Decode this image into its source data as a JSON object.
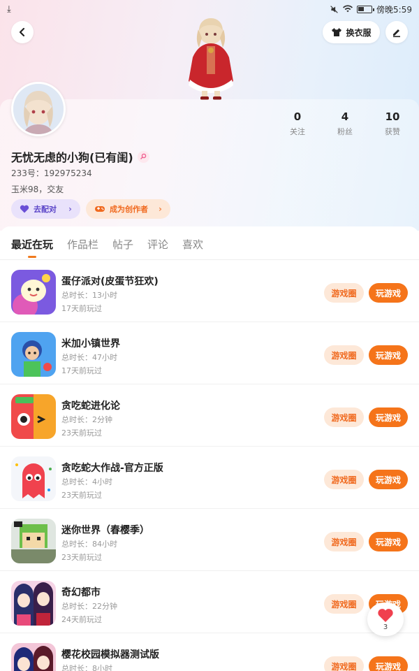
{
  "status_bar": {
    "time": "傍晚5:59"
  },
  "header": {
    "outfit_label": "换衣服"
  },
  "profile": {
    "stats": [
      {
        "value": "0",
        "label": "关注"
      },
      {
        "value": "4",
        "label": "粉丝"
      },
      {
        "value": "10",
        "label": "获赞"
      }
    ],
    "username": "无忧无虑的小狗(已有闺)",
    "uid": "233号：192975234",
    "bio": "玉米98，交友",
    "match_label": "去配对",
    "creator_label": "成为创作者"
  },
  "tabs": [
    {
      "label": "最近在玩",
      "active": true
    },
    {
      "label": "作品栏",
      "active": false
    },
    {
      "label": "帖子",
      "active": false
    },
    {
      "label": "评论",
      "active": false
    },
    {
      "label": "喜欢",
      "active": false
    }
  ],
  "games": [
    {
      "name": "蛋仔派对(皮蛋节狂欢)",
      "duration": "总时长：13小时",
      "last_played": "17天前玩过",
      "circle_label": "游戏圈",
      "play_label": "玩游戏"
    },
    {
      "name": "米加小镇世界",
      "duration": "总时长：47小时",
      "last_played": "17天前玩过",
      "circle_label": "游戏圈",
      "play_label": "玩游戏"
    },
    {
      "name": "贪吃蛇进化论",
      "duration": "总时长：2分钟",
      "last_played": "23天前玩过",
      "circle_label": "游戏圈",
      "play_label": "玩游戏"
    },
    {
      "name": "贪吃蛇大作战-官方正版",
      "duration": "总时长：4小时",
      "last_played": "23天前玩过",
      "circle_label": "游戏圈",
      "play_label": "玩游戏"
    },
    {
      "name": "迷你世界（春樱季）",
      "duration": "总时长：84小时",
      "last_played": "23天前玩过",
      "circle_label": "游戏圈",
      "play_label": "玩游戏"
    },
    {
      "name": "奇幻都市",
      "duration": "总时长：22分钟",
      "last_played": "24天前玩过",
      "circle_label": "游戏圈",
      "play_label": "玩游戏"
    },
    {
      "name": "樱花校园模拟器测试版",
      "duration": "总时长：8小时",
      "last_played": "",
      "circle_label": "游戏圈",
      "play_label": "玩游戏"
    }
  ],
  "fab": {
    "count": "3"
  },
  "colors": {
    "accent": "#f5741a",
    "accent_light": "#fde8d8",
    "match_bg": "#e9e2fb",
    "match_text": "#5b45c8"
  }
}
